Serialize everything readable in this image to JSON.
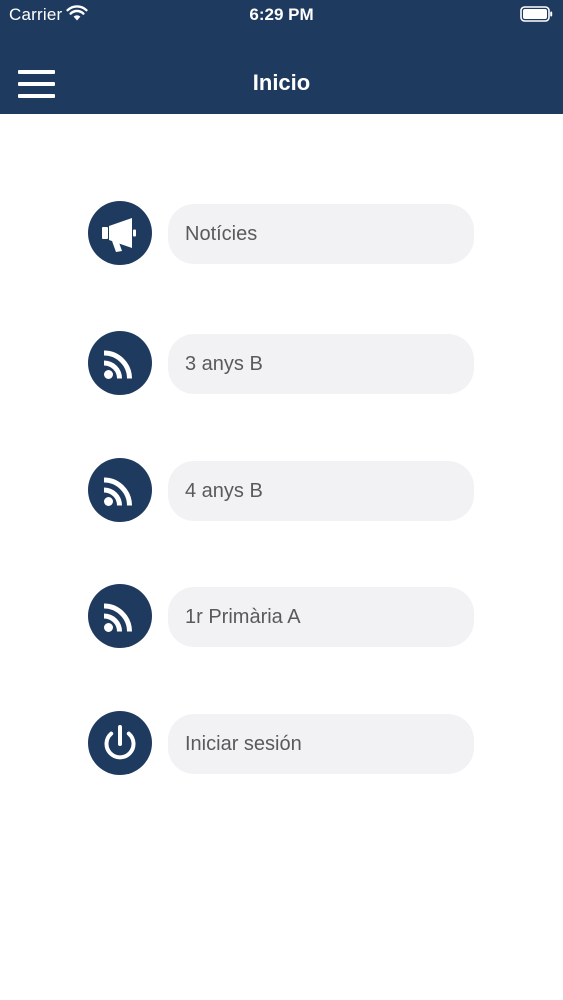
{
  "status_bar": {
    "carrier": "Carrier",
    "time": "6:29 PM"
  },
  "navbar": {
    "title": "Inicio"
  },
  "menu_items": [
    {
      "label": "Notícies",
      "icon": "megaphone-icon"
    },
    {
      "label": "3 anys B",
      "icon": "rss-icon"
    },
    {
      "label": "4 anys B",
      "icon": "rss-icon"
    },
    {
      "label": "1r Primària A",
      "icon": "rss-icon"
    },
    {
      "label": "Iniciar sesión",
      "icon": "power-icon"
    }
  ],
  "colors": {
    "brand": "#1f3a5f",
    "pill_background": "#f2f2f5",
    "label_text": "#5a5a5a"
  }
}
